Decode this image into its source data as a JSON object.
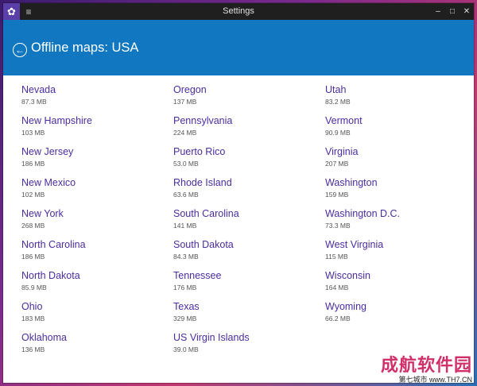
{
  "window": {
    "title": "Settings"
  },
  "titlebar": {
    "app_icon": "gear-icon",
    "menu_icon": "hamburger-icon",
    "minimize_glyph": "–",
    "maximize_glyph": "□",
    "close_glyph": "✕"
  },
  "header": {
    "back_glyph": "←",
    "title": "Offline maps: USA",
    "color": "#1077c0"
  },
  "columns": [
    [
      {
        "name": "Nevada",
        "size": "87.3 MB"
      },
      {
        "name": "New Hampshire",
        "size": "103 MB"
      },
      {
        "name": "New Jersey",
        "size": "186 MB"
      },
      {
        "name": "New Mexico",
        "size": "102 MB"
      },
      {
        "name": "New York",
        "size": "268 MB"
      },
      {
        "name": "North Carolina",
        "size": "186 MB"
      },
      {
        "name": "North Dakota",
        "size": "85.9 MB"
      },
      {
        "name": "Ohio",
        "size": "183 MB"
      },
      {
        "name": "Oklahoma",
        "size": "136 MB"
      }
    ],
    [
      {
        "name": "Oregon",
        "size": "137 MB"
      },
      {
        "name": "Pennsylvania",
        "size": "224 MB"
      },
      {
        "name": "Puerto Rico",
        "size": "53.0 MB"
      },
      {
        "name": "Rhode Island",
        "size": "63.6 MB"
      },
      {
        "name": "South Carolina",
        "size": "141 MB"
      },
      {
        "name": "South Dakota",
        "size": "84.3 MB"
      },
      {
        "name": "Tennessee",
        "size": "176 MB"
      },
      {
        "name": "Texas",
        "size": "329 MB"
      },
      {
        "name": "US Virgin Islands",
        "size": "39.0 MB"
      }
    ],
    [
      {
        "name": "Utah",
        "size": "83.2 MB"
      },
      {
        "name": "Vermont",
        "size": "90.9 MB"
      },
      {
        "name": "Virginia",
        "size": "207 MB"
      },
      {
        "name": "Washington",
        "size": "159 MB"
      },
      {
        "name": "Washington D.C.",
        "size": "73.3 MB"
      },
      {
        "name": "West Virginia",
        "size": "115 MB"
      },
      {
        "name": "Wisconsin",
        "size": "164 MB"
      },
      {
        "name": "Wyoming",
        "size": "66.2 MB"
      }
    ]
  ],
  "watermark": {
    "main": "成航软件园",
    "sub": "第七城市 www.TH7.CN"
  }
}
